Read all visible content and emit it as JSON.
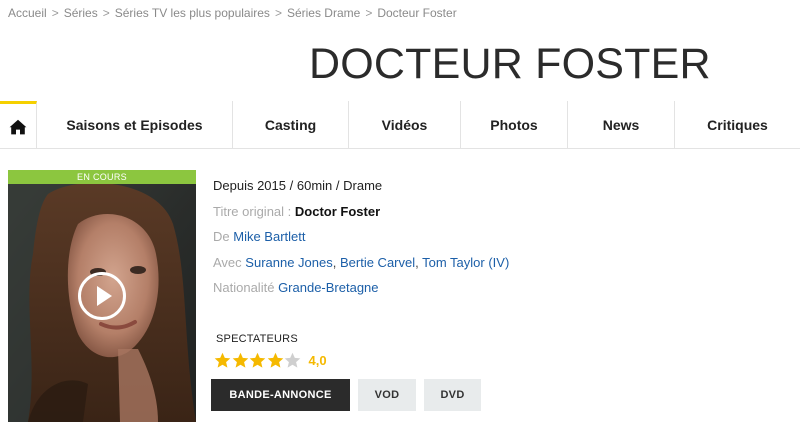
{
  "breadcrumb": {
    "items": [
      "Accueil",
      "Séries",
      "Séries TV les plus populaires",
      "Séries Drame"
    ],
    "separator": ">",
    "current": "Docteur Foster"
  },
  "title": "DOCTEUR FOSTER",
  "nav": {
    "home_icon": "home-icon",
    "tabs": [
      "Saisons et Episodes",
      "Casting",
      "Vidéos",
      "Photos",
      "News",
      "Critiques"
    ],
    "accent_color": "#f5d000"
  },
  "poster": {
    "badge": "EN COURS",
    "badge_color": "#8cc63f",
    "play_icon": "play-icon"
  },
  "info": {
    "since": "Depuis 2015",
    "duration": "60min",
    "genre": "Drame",
    "original_title_label": "Titre original :",
    "original_title": "Doctor Foster",
    "creator_label": "De",
    "creator": "Mike Bartlett",
    "cast_label": "Avec",
    "cast": [
      "Suranne Jones",
      "Bertie Carvel",
      "Tom Taylor (IV)"
    ],
    "nationality_label": "Nationalité",
    "nationality": "Grande-Bretagne"
  },
  "rating": {
    "label": "SPECTATEURS",
    "score_text": "4,0",
    "value": 4.0,
    "max": 5,
    "star_color": "#f5b900"
  },
  "buttons": {
    "trailer": "BANDE-ANNONCE",
    "vod": "VOD",
    "dvd": "DVD"
  },
  "link_color": "#1c5fa8"
}
